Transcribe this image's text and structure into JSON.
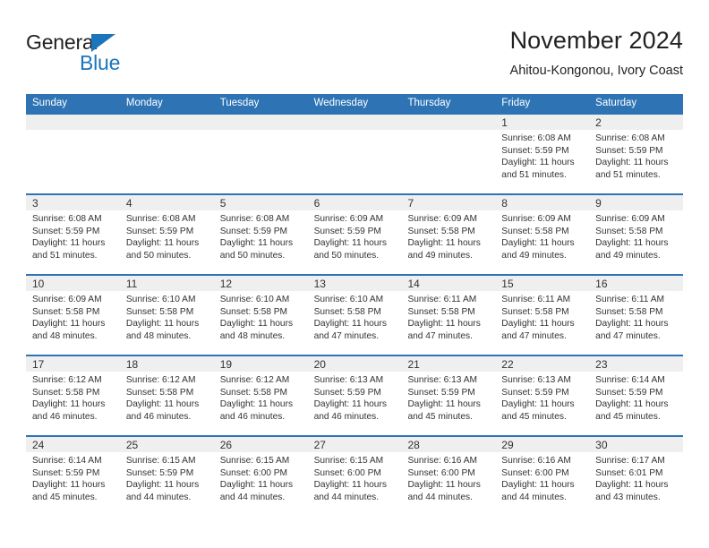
{
  "brand": {
    "name_part1": "General",
    "name_part2": "Blue",
    "triangle_color": "#1b75bc",
    "text_color": "#231f20"
  },
  "header": {
    "title": "November 2024",
    "subtitle": "Ahitou-Kongonou, Ivory Coast"
  },
  "theme": {
    "header_blue": "#2e74b5",
    "separator_blue": "#2e74b5",
    "day_band_gray": "#efefef",
    "text_color": "#333333"
  },
  "weekdays": [
    "Sunday",
    "Monday",
    "Tuesday",
    "Wednesday",
    "Thursday",
    "Friday",
    "Saturday"
  ],
  "labels": {
    "sunrise_prefix": "Sunrise: ",
    "sunset_prefix": "Sunset: ",
    "daylight_prefix": "Daylight: "
  },
  "weeks": [
    [
      {
        "day": "",
        "empty": true
      },
      {
        "day": "",
        "empty": true
      },
      {
        "day": "",
        "empty": true
      },
      {
        "day": "",
        "empty": true
      },
      {
        "day": "",
        "empty": true
      },
      {
        "day": "1",
        "sunrise": "Sunrise: 6:08 AM",
        "sunset": "Sunset: 5:59 PM",
        "daylight_line1": "Daylight: 11 hours",
        "daylight_line2": "and 51 minutes."
      },
      {
        "day": "2",
        "sunrise": "Sunrise: 6:08 AM",
        "sunset": "Sunset: 5:59 PM",
        "daylight_line1": "Daylight: 11 hours",
        "daylight_line2": "and 51 minutes."
      }
    ],
    [
      {
        "day": "3",
        "sunrise": "Sunrise: 6:08 AM",
        "sunset": "Sunset: 5:59 PM",
        "daylight_line1": "Daylight: 11 hours",
        "daylight_line2": "and 51 minutes."
      },
      {
        "day": "4",
        "sunrise": "Sunrise: 6:08 AM",
        "sunset": "Sunset: 5:59 PM",
        "daylight_line1": "Daylight: 11 hours",
        "daylight_line2": "and 50 minutes."
      },
      {
        "day": "5",
        "sunrise": "Sunrise: 6:08 AM",
        "sunset": "Sunset: 5:59 PM",
        "daylight_line1": "Daylight: 11 hours",
        "daylight_line2": "and 50 minutes."
      },
      {
        "day": "6",
        "sunrise": "Sunrise: 6:09 AM",
        "sunset": "Sunset: 5:59 PM",
        "daylight_line1": "Daylight: 11 hours",
        "daylight_line2": "and 50 minutes."
      },
      {
        "day": "7",
        "sunrise": "Sunrise: 6:09 AM",
        "sunset": "Sunset: 5:58 PM",
        "daylight_line1": "Daylight: 11 hours",
        "daylight_line2": "and 49 minutes."
      },
      {
        "day": "8",
        "sunrise": "Sunrise: 6:09 AM",
        "sunset": "Sunset: 5:58 PM",
        "daylight_line1": "Daylight: 11 hours",
        "daylight_line2": "and 49 minutes."
      },
      {
        "day": "9",
        "sunrise": "Sunrise: 6:09 AM",
        "sunset": "Sunset: 5:58 PM",
        "daylight_line1": "Daylight: 11 hours",
        "daylight_line2": "and 49 minutes."
      }
    ],
    [
      {
        "day": "10",
        "sunrise": "Sunrise: 6:09 AM",
        "sunset": "Sunset: 5:58 PM",
        "daylight_line1": "Daylight: 11 hours",
        "daylight_line2": "and 48 minutes."
      },
      {
        "day": "11",
        "sunrise": "Sunrise: 6:10 AM",
        "sunset": "Sunset: 5:58 PM",
        "daylight_line1": "Daylight: 11 hours",
        "daylight_line2": "and 48 minutes."
      },
      {
        "day": "12",
        "sunrise": "Sunrise: 6:10 AM",
        "sunset": "Sunset: 5:58 PM",
        "daylight_line1": "Daylight: 11 hours",
        "daylight_line2": "and 48 minutes."
      },
      {
        "day": "13",
        "sunrise": "Sunrise: 6:10 AM",
        "sunset": "Sunset: 5:58 PM",
        "daylight_line1": "Daylight: 11 hours",
        "daylight_line2": "and 47 minutes."
      },
      {
        "day": "14",
        "sunrise": "Sunrise: 6:11 AM",
        "sunset": "Sunset: 5:58 PM",
        "daylight_line1": "Daylight: 11 hours",
        "daylight_line2": "and 47 minutes."
      },
      {
        "day": "15",
        "sunrise": "Sunrise: 6:11 AM",
        "sunset": "Sunset: 5:58 PM",
        "daylight_line1": "Daylight: 11 hours",
        "daylight_line2": "and 47 minutes."
      },
      {
        "day": "16",
        "sunrise": "Sunrise: 6:11 AM",
        "sunset": "Sunset: 5:58 PM",
        "daylight_line1": "Daylight: 11 hours",
        "daylight_line2": "and 47 minutes."
      }
    ],
    [
      {
        "day": "17",
        "sunrise": "Sunrise: 6:12 AM",
        "sunset": "Sunset: 5:58 PM",
        "daylight_line1": "Daylight: 11 hours",
        "daylight_line2": "and 46 minutes."
      },
      {
        "day": "18",
        "sunrise": "Sunrise: 6:12 AM",
        "sunset": "Sunset: 5:58 PM",
        "daylight_line1": "Daylight: 11 hours",
        "daylight_line2": "and 46 minutes."
      },
      {
        "day": "19",
        "sunrise": "Sunrise: 6:12 AM",
        "sunset": "Sunset: 5:58 PM",
        "daylight_line1": "Daylight: 11 hours",
        "daylight_line2": "and 46 minutes."
      },
      {
        "day": "20",
        "sunrise": "Sunrise: 6:13 AM",
        "sunset": "Sunset: 5:59 PM",
        "daylight_line1": "Daylight: 11 hours",
        "daylight_line2": "and 46 minutes."
      },
      {
        "day": "21",
        "sunrise": "Sunrise: 6:13 AM",
        "sunset": "Sunset: 5:59 PM",
        "daylight_line1": "Daylight: 11 hours",
        "daylight_line2": "and 45 minutes."
      },
      {
        "day": "22",
        "sunrise": "Sunrise: 6:13 AM",
        "sunset": "Sunset: 5:59 PM",
        "daylight_line1": "Daylight: 11 hours",
        "daylight_line2": "and 45 minutes."
      },
      {
        "day": "23",
        "sunrise": "Sunrise: 6:14 AM",
        "sunset": "Sunset: 5:59 PM",
        "daylight_line1": "Daylight: 11 hours",
        "daylight_line2": "and 45 minutes."
      }
    ],
    [
      {
        "day": "24",
        "sunrise": "Sunrise: 6:14 AM",
        "sunset": "Sunset: 5:59 PM",
        "daylight_line1": "Daylight: 11 hours",
        "daylight_line2": "and 45 minutes."
      },
      {
        "day": "25",
        "sunrise": "Sunrise: 6:15 AM",
        "sunset": "Sunset: 5:59 PM",
        "daylight_line1": "Daylight: 11 hours",
        "daylight_line2": "and 44 minutes."
      },
      {
        "day": "26",
        "sunrise": "Sunrise: 6:15 AM",
        "sunset": "Sunset: 6:00 PM",
        "daylight_line1": "Daylight: 11 hours",
        "daylight_line2": "and 44 minutes."
      },
      {
        "day": "27",
        "sunrise": "Sunrise: 6:15 AM",
        "sunset": "Sunset: 6:00 PM",
        "daylight_line1": "Daylight: 11 hours",
        "daylight_line2": "and 44 minutes."
      },
      {
        "day": "28",
        "sunrise": "Sunrise: 6:16 AM",
        "sunset": "Sunset: 6:00 PM",
        "daylight_line1": "Daylight: 11 hours",
        "daylight_line2": "and 44 minutes."
      },
      {
        "day": "29",
        "sunrise": "Sunrise: 6:16 AM",
        "sunset": "Sunset: 6:00 PM",
        "daylight_line1": "Daylight: 11 hours",
        "daylight_line2": "and 44 minutes."
      },
      {
        "day": "30",
        "sunrise": "Sunrise: 6:17 AM",
        "sunset": "Sunset: 6:01 PM",
        "daylight_line1": "Daylight: 11 hours",
        "daylight_line2": "and 43 minutes."
      }
    ]
  ]
}
